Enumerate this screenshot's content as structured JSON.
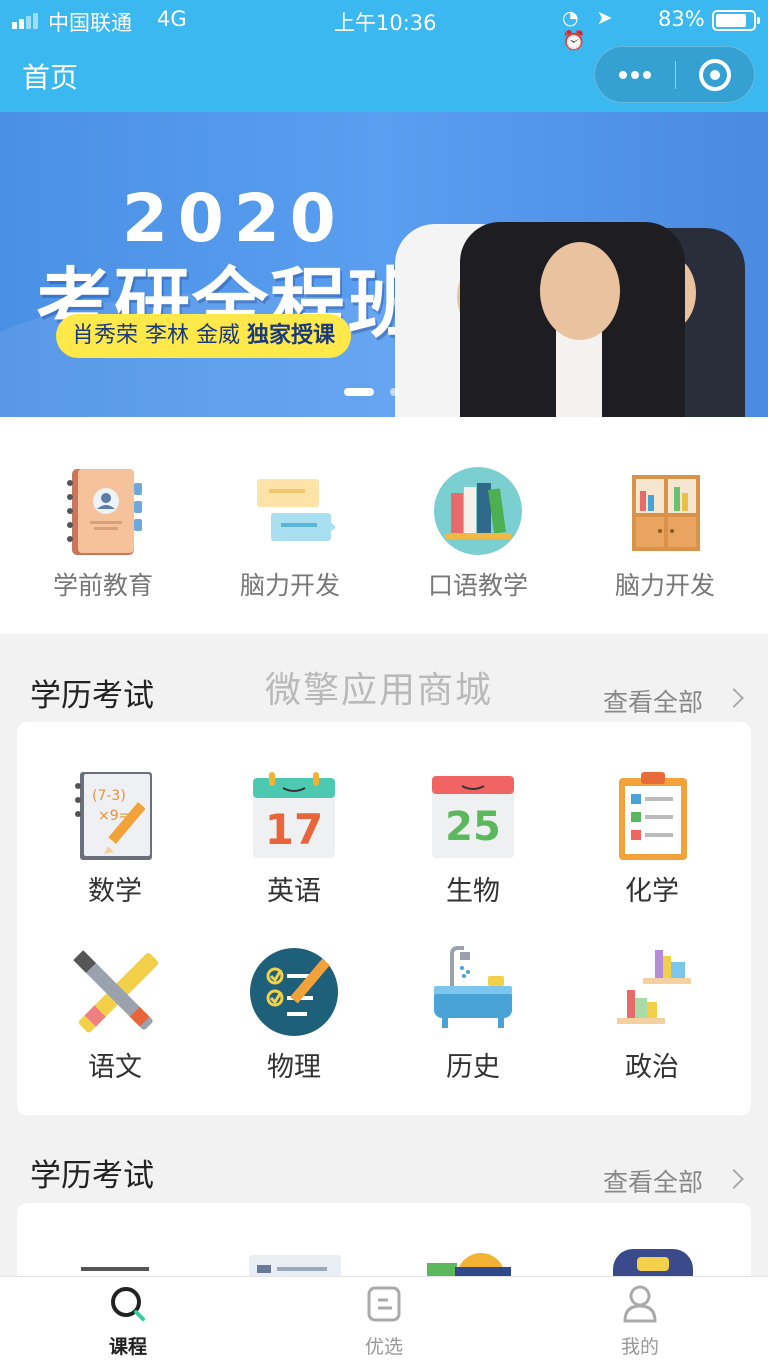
{
  "status_bar": {
    "carrier": "中国联通",
    "network": "4G",
    "time": "上午10:36",
    "battery": "83%",
    "battery_level": 0.83
  },
  "title_bar": {
    "title": "首页"
  },
  "banner": {
    "year": "2020",
    "title": "考研全程班",
    "teachers": "肖秀荣  李林  金威",
    "tagline": "独家授课",
    "current_slide": 1
  },
  "quick_nav": [
    {
      "label": "学前教育",
      "icon": "notebook-icon"
    },
    {
      "label": "脑力开发",
      "icon": "chat-bubbles-icon"
    },
    {
      "label": "口语教学",
      "icon": "books-icon"
    },
    {
      "label": "脑力开发",
      "icon": "bookshelf-icon"
    }
  ],
  "watermark": "微擎应用商城",
  "section1": {
    "title": "学历考试",
    "more": "查看全部",
    "subjects": [
      {
        "label": "数学",
        "icon": "math-notebook-icon"
      },
      {
        "label": "英语",
        "icon": "calendar-17-icon"
      },
      {
        "label": "生物",
        "icon": "calendar-25-icon"
      },
      {
        "label": "化学",
        "icon": "clipboard-icon"
      },
      {
        "label": "语文",
        "icon": "pencil-pen-icon"
      },
      {
        "label": "物理",
        "icon": "checklist-icon"
      },
      {
        "label": "历史",
        "icon": "bathtub-icon"
      },
      {
        "label": "政治",
        "icon": "shelves-icon"
      }
    ],
    "calendar_numbers": [
      "17",
      "25"
    ],
    "math_text": [
      "(7-3)",
      "×9="
    ]
  },
  "section2": {
    "title": "学历考试",
    "more": "查看全部"
  },
  "tab_bar": [
    {
      "label": "课程",
      "icon": "search-icon",
      "active": true
    },
    {
      "label": "优选",
      "icon": "note-icon",
      "active": false
    },
    {
      "label": "我的",
      "icon": "user-icon",
      "active": false
    }
  ],
  "colors": {
    "primary": "#3cb8f0",
    "banner_blue": "#4a90e4",
    "tag_yellow": "#ffe84a"
  }
}
